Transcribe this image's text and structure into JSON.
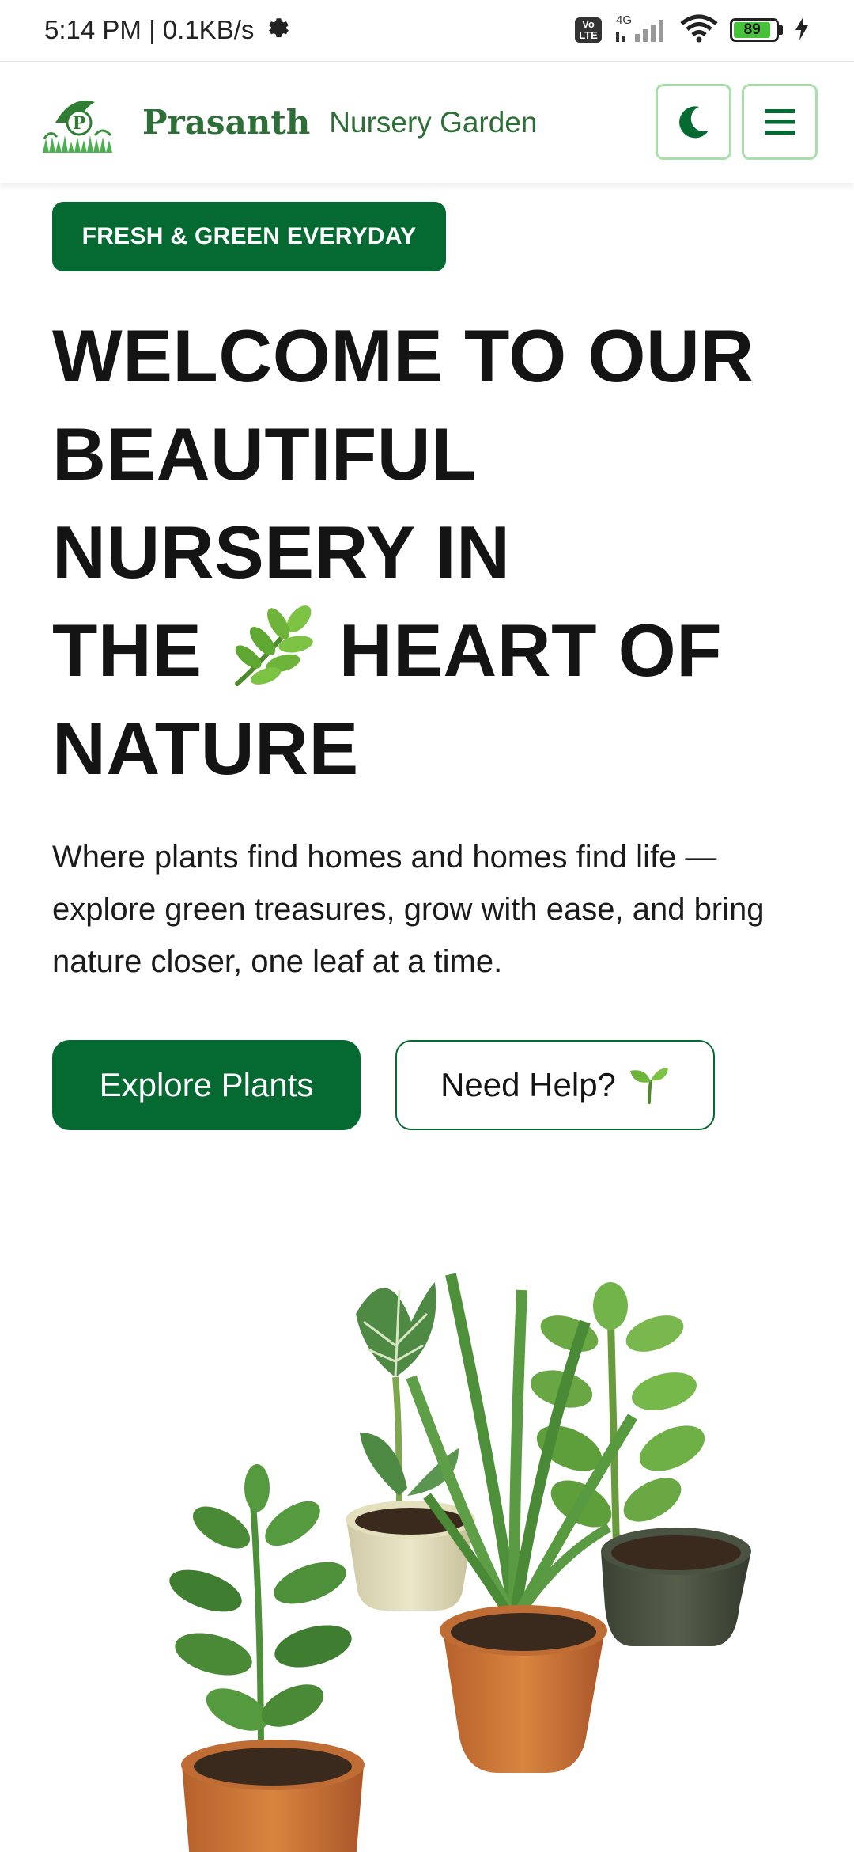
{
  "status_bar": {
    "time_speed": "5:14 PM | 0.1KB/s",
    "network": "4G",
    "volte": "Vo LTE",
    "battery": "89",
    "battery_level_percent": 89
  },
  "header": {
    "brand_name": "Prasanth",
    "brand_subtitle": "Nursery Garden",
    "logo_letter": "P"
  },
  "hero": {
    "badge": "FRESH & GREEN EVERYDAY",
    "headline_line1": "WELCOME TO OUR",
    "headline_line2": "BEAUTIFUL",
    "headline_line3": "NURSERY IN",
    "headline_line4a": "THE",
    "headline_line4b": "HEART OF",
    "headline_line5": "NATURE",
    "description": "Where plants find homes and homes find life — explore green treasures, grow with ease, and bring nature closer, one leaf at a time.",
    "primary_cta": "Explore Plants",
    "secondary_cta": "Need Help?"
  },
  "colors": {
    "brand_green": "#056a31",
    "text_green": "#2e6e37",
    "border_green": "#a9dfaa"
  }
}
